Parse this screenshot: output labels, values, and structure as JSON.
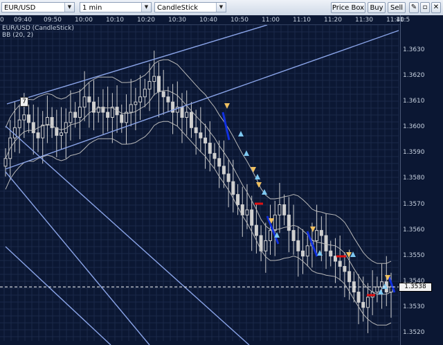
{
  "toolbar": {
    "symbol": "EUR/USD",
    "timeframe": "1 min",
    "chart_style": "CandleStick",
    "price_box_label": "Price Box",
    "buy_label": "Buy",
    "sell_label": "Sell",
    "colors": {
      "toolbar_bg": "#dbe3ee"
    }
  },
  "chart": {
    "instrument_label": "EUR/USD (CandleStick)",
    "indicator_label": "BB (20, 2)",
    "wave_label": "7",
    "current_price_label": "1.3538",
    "colors": {
      "background": "#0b1733",
      "grid": "#1b2a4a",
      "candles": "#cfcfcf",
      "bands": "#b8b8b8",
      "trendlines": "#8aa4e8",
      "up_arrow": "#7ec8f0",
      "down_arrow": "#f0c060",
      "blue_segment": "#1030e0",
      "red_segment": "#e01010",
      "price_line": "#ffffff"
    }
  },
  "chart_data": {
    "type": "candlestick",
    "title": "EUR/USD (CandleStick)",
    "indicators": [
      {
        "name": "BB (20, 2)"
      }
    ],
    "x_ticks": [
      "0",
      "09:40",
      "09:50",
      "10:00",
      "10:10",
      "10:20",
      "10:30",
      "10:40",
      "10:50",
      "11:00",
      "11:10",
      "11:20",
      "11:30",
      "11:40",
      "11:5"
    ],
    "y_ticks": [
      "1.3630",
      "1.3620",
      "1.3610",
      "1.3600",
      "1.3590",
      "1.3580",
      "1.3570",
      "1.3560",
      "1.3550",
      "1.3540",
      "1.3530",
      "1.3520"
    ],
    "ylim": [
      1.3517,
      1.364
    ],
    "current_price": 1.3538,
    "close_series": [
      1.3588,
      1.3596,
      1.36,
      1.3603,
      1.3605,
      1.3602,
      1.3598,
      1.3596,
      1.3601,
      1.3604,
      1.36,
      1.3597,
      1.3598,
      1.3602,
      1.3606,
      1.3604,
      1.3608,
      1.3612,
      1.361,
      1.3606,
      1.3608,
      1.3606,
      1.3604,
      1.3608,
      1.3605,
      1.3602,
      1.3606,
      1.3609,
      1.361,
      1.3612,
      1.3615,
      1.3618,
      1.362,
      1.3614,
      1.3612,
      1.361,
      1.3606,
      1.3608,
      1.3604,
      1.3606,
      1.36,
      1.3598,
      1.3596,
      1.3594,
      1.359,
      1.3588,
      1.3585,
      1.3582,
      1.3579,
      1.3574,
      1.357,
      1.3566,
      1.3568,
      1.3562,
      1.3558,
      1.3552,
      1.3556,
      1.356,
      1.3566,
      1.357,
      1.3566,
      1.356,
      1.3556,
      1.3552,
      1.355,
      1.3554,
      1.3556,
      1.356,
      1.3558,
      1.3552,
      1.355,
      1.3548,
      1.3546,
      1.3544,
      1.354,
      1.3536,
      1.3532,
      1.353,
      1.3534,
      1.3536,
      1.3538,
      1.354,
      1.3536,
      1.3538
    ]
  }
}
